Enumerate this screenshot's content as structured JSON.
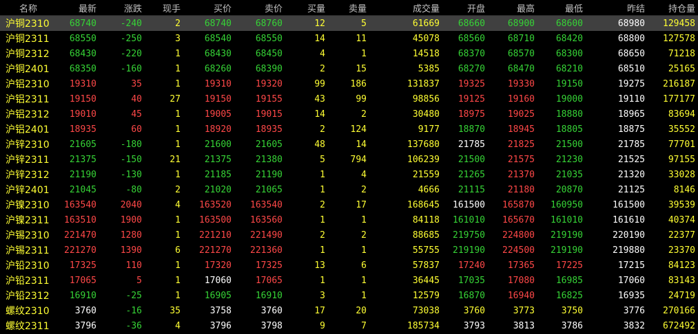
{
  "colors": {
    "up": "#ff4848",
    "down": "#36d436",
    "yellow": "#ffff33",
    "white": "#ffffff",
    "header": "#c0c0c0",
    "selected_bg": "#404040"
  },
  "headers": [
    "名称",
    "最新",
    "涨跌",
    "现手",
    "买价",
    "卖价",
    "买量",
    "卖量",
    "成交量",
    "开盘",
    "最高",
    "最低",
    "昨结",
    "持仓量"
  ],
  "rows": [
    {
      "name": "沪铜2310",
      "last": "68740",
      "chg": "-240",
      "cur": "2",
      "bid": "68740",
      "ask": "68760",
      "bidv": "12",
      "askv": "5",
      "vol": "61669",
      "open": "68660",
      "high": "68900",
      "low": "68600",
      "pre": "68980",
      "oi": "129458",
      "dir": "dn",
      "o": "dn",
      "h": "dn",
      "l": "dn",
      "selected": true
    },
    {
      "name": "沪铜2311",
      "last": "68550",
      "chg": "-250",
      "cur": "3",
      "bid": "68540",
      "ask": "68550",
      "bidv": "14",
      "askv": "11",
      "vol": "45078",
      "open": "68560",
      "high": "68710",
      "low": "68420",
      "pre": "68800",
      "oi": "127578",
      "dir": "dn",
      "o": "dn",
      "h": "dn",
      "l": "dn"
    },
    {
      "name": "沪铜2312",
      "last": "68430",
      "chg": "-220",
      "cur": "1",
      "bid": "68430",
      "ask": "68450",
      "bidv": "4",
      "askv": "1",
      "vol": "14518",
      "open": "68370",
      "high": "68570",
      "low": "68300",
      "pre": "68650",
      "oi": "71218",
      "dir": "dn",
      "o": "dn",
      "h": "dn",
      "l": "dn"
    },
    {
      "name": "沪铜2401",
      "last": "68350",
      "chg": "-160",
      "cur": "1",
      "bid": "68260",
      "ask": "68390",
      "bidv": "2",
      "askv": "15",
      "vol": "5385",
      "open": "68270",
      "high": "68470",
      "low": "68210",
      "pre": "68510",
      "oi": "25165",
      "dir": "dn",
      "o": "dn",
      "h": "dn",
      "l": "dn"
    },
    {
      "name": "沪铝2310",
      "last": "19310",
      "chg": "35",
      "cur": "1",
      "bid": "19310",
      "ask": "19320",
      "bidv": "99",
      "askv": "186",
      "vol": "131837",
      "open": "19325",
      "high": "19330",
      "low": "19150",
      "pre": "19275",
      "oi": "216187",
      "dir": "up",
      "o": "up",
      "h": "up",
      "l": "dn"
    },
    {
      "name": "沪铝2311",
      "last": "19150",
      "chg": "40",
      "cur": "27",
      "bid": "19150",
      "ask": "19155",
      "bidv": "43",
      "askv": "99",
      "vol": "98856",
      "open": "19125",
      "high": "19160",
      "low": "19000",
      "pre": "19110",
      "oi": "177177",
      "dir": "up",
      "o": "up",
      "h": "up",
      "l": "dn"
    },
    {
      "name": "沪铝2312",
      "last": "19010",
      "chg": "45",
      "cur": "1",
      "bid": "19005",
      "ask": "19015",
      "bidv": "14",
      "askv": "2",
      "vol": "30480",
      "open": "18975",
      "high": "19025",
      "low": "18880",
      "pre": "18965",
      "oi": "83694",
      "dir": "up",
      "o": "up",
      "h": "up",
      "l": "dn"
    },
    {
      "name": "沪铝2401",
      "last": "18935",
      "chg": "60",
      "cur": "1",
      "bid": "18920",
      "ask": "18935",
      "bidv": "2",
      "askv": "124",
      "vol": "9177",
      "open": "18870",
      "high": "18945",
      "low": "18805",
      "pre": "18875",
      "oi": "35552",
      "dir": "up",
      "o": "dn",
      "h": "up",
      "l": "dn"
    },
    {
      "name": "沪锌2310",
      "last": "21605",
      "chg": "-180",
      "cur": "1",
      "bid": "21600",
      "ask": "21605",
      "bidv": "48",
      "askv": "14",
      "vol": "137680",
      "open": "21785",
      "high": "21825",
      "low": "21500",
      "pre": "21785",
      "oi": "77701",
      "dir": "dn",
      "o": "wh",
      "h": "up",
      "l": "dn"
    },
    {
      "name": "沪锌2311",
      "last": "21375",
      "chg": "-150",
      "cur": "21",
      "bid": "21375",
      "ask": "21380",
      "bidv": "5",
      "askv": "794",
      "vol": "106239",
      "open": "21500",
      "high": "21575",
      "low": "21230",
      "pre": "21525",
      "oi": "97155",
      "dir": "dn",
      "o": "dn",
      "h": "up",
      "l": "dn"
    },
    {
      "name": "沪锌2312",
      "last": "21190",
      "chg": "-130",
      "cur": "1",
      "bid": "21185",
      "ask": "21190",
      "bidv": "1",
      "askv": "4",
      "vol": "21559",
      "open": "21265",
      "high": "21370",
      "low": "21035",
      "pre": "21320",
      "oi": "33028",
      "dir": "dn",
      "o": "dn",
      "h": "up",
      "l": "dn"
    },
    {
      "name": "沪锌2401",
      "last": "21045",
      "chg": "-80",
      "cur": "2",
      "bid": "21020",
      "ask": "21065",
      "bidv": "1",
      "askv": "2",
      "vol": "4666",
      "open": "21115",
      "high": "21180",
      "low": "20870",
      "pre": "21125",
      "oi": "8146",
      "dir": "dn",
      "o": "dn",
      "h": "up",
      "l": "dn"
    },
    {
      "name": "沪镍2310",
      "last": "163540",
      "chg": "2040",
      "cur": "4",
      "bid": "163520",
      "ask": "163540",
      "bidv": "2",
      "askv": "17",
      "vol": "168645",
      "open": "161500",
      "high": "165870",
      "low": "160950",
      "pre": "161500",
      "oi": "39539",
      "dir": "up",
      "o": "wh",
      "h": "up",
      "l": "dn"
    },
    {
      "name": "沪镍2311",
      "last": "163510",
      "chg": "1900",
      "cur": "1",
      "bid": "163500",
      "ask": "163560",
      "bidv": "1",
      "askv": "1",
      "vol": "84118",
      "open": "161010",
      "high": "165670",
      "low": "161010",
      "pre": "161610",
      "oi": "40374",
      "dir": "up",
      "o": "dn",
      "h": "up",
      "l": "dn"
    },
    {
      "name": "沪锡2310",
      "last": "221470",
      "chg": "1280",
      "cur": "1",
      "bid": "221210",
      "ask": "221490",
      "bidv": "2",
      "askv": "2",
      "vol": "88685",
      "open": "219750",
      "high": "224800",
      "low": "219190",
      "pre": "220190",
      "oi": "22377",
      "dir": "up",
      "o": "dn",
      "h": "up",
      "l": "dn"
    },
    {
      "name": "沪锡2311",
      "last": "221270",
      "chg": "1390",
      "cur": "6",
      "bid": "221270",
      "ask": "221360",
      "bidv": "1",
      "askv": "1",
      "vol": "55755",
      "open": "219190",
      "high": "224500",
      "low": "219190",
      "pre": "219880",
      "oi": "23370",
      "dir": "up",
      "o": "dn",
      "h": "up",
      "l": "dn"
    },
    {
      "name": "沪铅2310",
      "last": "17325",
      "chg": "110",
      "cur": "1",
      "bid": "17320",
      "ask": "17325",
      "bidv": "13",
      "askv": "6",
      "vol": "57837",
      "open": "17240",
      "high": "17365",
      "low": "17225",
      "pre": "17215",
      "oi": "84123",
      "dir": "up",
      "o": "up",
      "h": "up",
      "l": "up"
    },
    {
      "name": "沪铅2311",
      "last": "17065",
      "chg": "5",
      "cur": "1",
      "bid": "17060",
      "ask": "17065",
      "bidv": "1",
      "askv": "1",
      "vol": "36445",
      "open": "17035",
      "high": "17080",
      "low": "16985",
      "pre": "17060",
      "oi": "83143",
      "dir": "up",
      "o": "dn",
      "h": "up",
      "l": "dn",
      "bidw": true
    },
    {
      "name": "沪铅2312",
      "last": "16910",
      "chg": "-25",
      "cur": "1",
      "bid": "16905",
      "ask": "16910",
      "bidv": "3",
      "askv": "1",
      "vol": "12579",
      "open": "16870",
      "high": "16940",
      "low": "16825",
      "pre": "16935",
      "oi": "24719",
      "dir": "dn",
      "o": "dn",
      "h": "up",
      "l": "dn"
    },
    {
      "name": "螺纹2310",
      "last": "3760",
      "chg": "-16",
      "cur": "35",
      "bid": "3758",
      "ask": "3760",
      "bidv": "17",
      "askv": "20",
      "vol": "73038",
      "open": "3760",
      "high": "3773",
      "low": "3750",
      "pre": "3776",
      "oi": "270166",
      "dir": "dn",
      "o": "dn",
      "h": "dn",
      "l": "dn",
      "mono": true
    },
    {
      "name": "螺纹2311",
      "last": "3796",
      "chg": "-36",
      "cur": "4",
      "bid": "3796",
      "ask": "3798",
      "bidv": "9",
      "askv": "7",
      "vol": "185734",
      "open": "3793",
      "high": "3813",
      "low": "3786",
      "pre": "3832",
      "oi": "672492",
      "dir": "dn",
      "o": "wh",
      "h": "wh",
      "l": "wh",
      "mono": true
    }
  ]
}
